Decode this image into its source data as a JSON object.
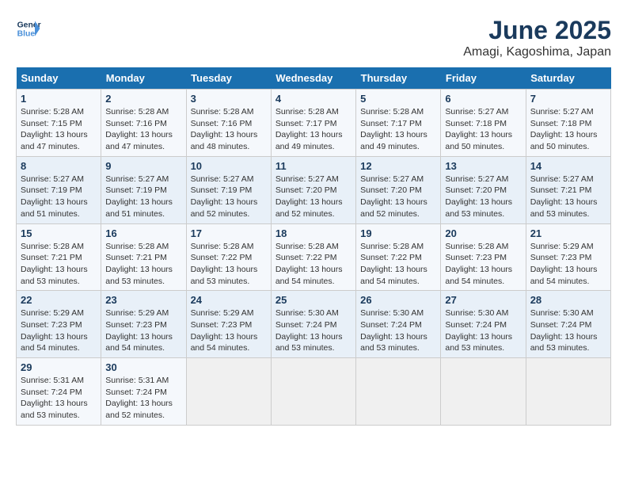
{
  "logo": {
    "text_general": "General",
    "text_blue": "Blue"
  },
  "title": "June 2025",
  "subtitle": "Amagi, Kagoshima, Japan",
  "days_of_week": [
    "Sunday",
    "Monday",
    "Tuesday",
    "Wednesday",
    "Thursday",
    "Friday",
    "Saturday"
  ],
  "weeks": [
    [
      {
        "day": 1,
        "sunrise": "5:28 AM",
        "sunset": "7:15 PM",
        "daylight": "13 hours and 47 minutes."
      },
      {
        "day": 2,
        "sunrise": "5:28 AM",
        "sunset": "7:16 PM",
        "daylight": "13 hours and 47 minutes."
      },
      {
        "day": 3,
        "sunrise": "5:28 AM",
        "sunset": "7:16 PM",
        "daylight": "13 hours and 48 minutes."
      },
      {
        "day": 4,
        "sunrise": "5:28 AM",
        "sunset": "7:17 PM",
        "daylight": "13 hours and 49 minutes."
      },
      {
        "day": 5,
        "sunrise": "5:28 AM",
        "sunset": "7:17 PM",
        "daylight": "13 hours and 49 minutes."
      },
      {
        "day": 6,
        "sunrise": "5:27 AM",
        "sunset": "7:18 PM",
        "daylight": "13 hours and 50 minutes."
      },
      {
        "day": 7,
        "sunrise": "5:27 AM",
        "sunset": "7:18 PM",
        "daylight": "13 hours and 50 minutes."
      }
    ],
    [
      {
        "day": 8,
        "sunrise": "5:27 AM",
        "sunset": "7:19 PM",
        "daylight": "13 hours and 51 minutes."
      },
      {
        "day": 9,
        "sunrise": "5:27 AM",
        "sunset": "7:19 PM",
        "daylight": "13 hours and 51 minutes."
      },
      {
        "day": 10,
        "sunrise": "5:27 AM",
        "sunset": "7:19 PM",
        "daylight": "13 hours and 52 minutes."
      },
      {
        "day": 11,
        "sunrise": "5:27 AM",
        "sunset": "7:20 PM",
        "daylight": "13 hours and 52 minutes."
      },
      {
        "day": 12,
        "sunrise": "5:27 AM",
        "sunset": "7:20 PM",
        "daylight": "13 hours and 52 minutes."
      },
      {
        "day": 13,
        "sunrise": "5:27 AM",
        "sunset": "7:20 PM",
        "daylight": "13 hours and 53 minutes."
      },
      {
        "day": 14,
        "sunrise": "5:27 AM",
        "sunset": "7:21 PM",
        "daylight": "13 hours and 53 minutes."
      }
    ],
    [
      {
        "day": 15,
        "sunrise": "5:28 AM",
        "sunset": "7:21 PM",
        "daylight": "13 hours and 53 minutes."
      },
      {
        "day": 16,
        "sunrise": "5:28 AM",
        "sunset": "7:21 PM",
        "daylight": "13 hours and 53 minutes."
      },
      {
        "day": 17,
        "sunrise": "5:28 AM",
        "sunset": "7:22 PM",
        "daylight": "13 hours and 53 minutes."
      },
      {
        "day": 18,
        "sunrise": "5:28 AM",
        "sunset": "7:22 PM",
        "daylight": "13 hours and 54 minutes."
      },
      {
        "day": 19,
        "sunrise": "5:28 AM",
        "sunset": "7:22 PM",
        "daylight": "13 hours and 54 minutes."
      },
      {
        "day": 20,
        "sunrise": "5:28 AM",
        "sunset": "7:23 PM",
        "daylight": "13 hours and 54 minutes."
      },
      {
        "day": 21,
        "sunrise": "5:29 AM",
        "sunset": "7:23 PM",
        "daylight": "13 hours and 54 minutes."
      }
    ],
    [
      {
        "day": 22,
        "sunrise": "5:29 AM",
        "sunset": "7:23 PM",
        "daylight": "13 hours and 54 minutes."
      },
      {
        "day": 23,
        "sunrise": "5:29 AM",
        "sunset": "7:23 PM",
        "daylight": "13 hours and 54 minutes."
      },
      {
        "day": 24,
        "sunrise": "5:29 AM",
        "sunset": "7:23 PM",
        "daylight": "13 hours and 54 minutes."
      },
      {
        "day": 25,
        "sunrise": "5:30 AM",
        "sunset": "7:24 PM",
        "daylight": "13 hours and 53 minutes."
      },
      {
        "day": 26,
        "sunrise": "5:30 AM",
        "sunset": "7:24 PM",
        "daylight": "13 hours and 53 minutes."
      },
      {
        "day": 27,
        "sunrise": "5:30 AM",
        "sunset": "7:24 PM",
        "daylight": "13 hours and 53 minutes."
      },
      {
        "day": 28,
        "sunrise": "5:30 AM",
        "sunset": "7:24 PM",
        "daylight": "13 hours and 53 minutes."
      }
    ],
    [
      {
        "day": 29,
        "sunrise": "5:31 AM",
        "sunset": "7:24 PM",
        "daylight": "13 hours and 53 minutes."
      },
      {
        "day": 30,
        "sunrise": "5:31 AM",
        "sunset": "7:24 PM",
        "daylight": "13 hours and 52 minutes."
      },
      null,
      null,
      null,
      null,
      null
    ]
  ]
}
